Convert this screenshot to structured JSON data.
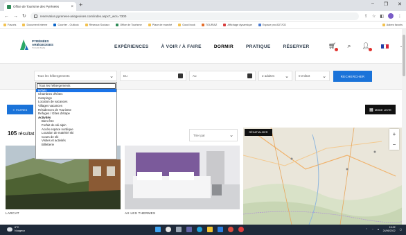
{
  "browser": {
    "tab_title": "Office de Tourisme des Pyrénées",
    "url": "reservation.pyrenees-ariegeoises.com/index.aspx?_wcs=7300",
    "bookmarks": [
      "Favoris",
      "Document interne",
      "Courrier - Outlook",
      "Réseaux Sociaux",
      "Office de Tourisme",
      "Place de marché",
      "Good book",
      "TOURIAZ",
      "Affichage dynamique",
      "Espace pro ADT/CD"
    ],
    "other_bookmarks": "Autres favoris"
  },
  "site": {
    "logo_line1": "PYRÉNÉES",
    "logo_line2": "ARIÉGEOISES",
    "logo_sub": "TOURISME",
    "nav": [
      "EXPÉRIENCES",
      "À VOIR / À FAIRE",
      "DORMIR",
      "PRATIQUE",
      "RÉSERVER"
    ],
    "flag_colors": [
      "#1f3fa8",
      "#ffffff",
      "#d6263a"
    ]
  },
  "search": {
    "type_value": "Tous les hébergements",
    "from_label": "Du",
    "to_label": "Au",
    "adults_value": "2 adultes",
    "children_value": "0 enfant",
    "button_label": "RECHERCHER"
  },
  "dropdown": {
    "items": [
      "Tous les hébergements",
      "Hôtels",
      "Chambres d'hôtes",
      "Campings",
      "Location de vacances",
      "Villages vacances",
      "Résidences de Tourisme",
      "Refuges / Gîtes d'étape"
    ],
    "group_label": "Activités",
    "sub_items": [
      "Bien-être",
      "Forfait de ski alpin",
      "Accès espace nordique",
      "Location de matériel ski",
      "Cours de ski",
      "Visites et activités",
      "Billetterie"
    ]
  },
  "filters": {
    "filtres_label": "FILTRES",
    "liste_label": "MODE LISTE",
    "results_count": "105",
    "results_label": "résultat",
    "sort_label": "Trier par",
    "reset_label": "RÉINITIALISER"
  },
  "cards": [
    {
      "title": "LARCAT"
    },
    {
      "title": "AX LES THERMES"
    }
  ],
  "taskbar": {
    "temp": "6°C",
    "weather": "Nuageux",
    "time": "15:22",
    "date": "24/06/2022"
  }
}
